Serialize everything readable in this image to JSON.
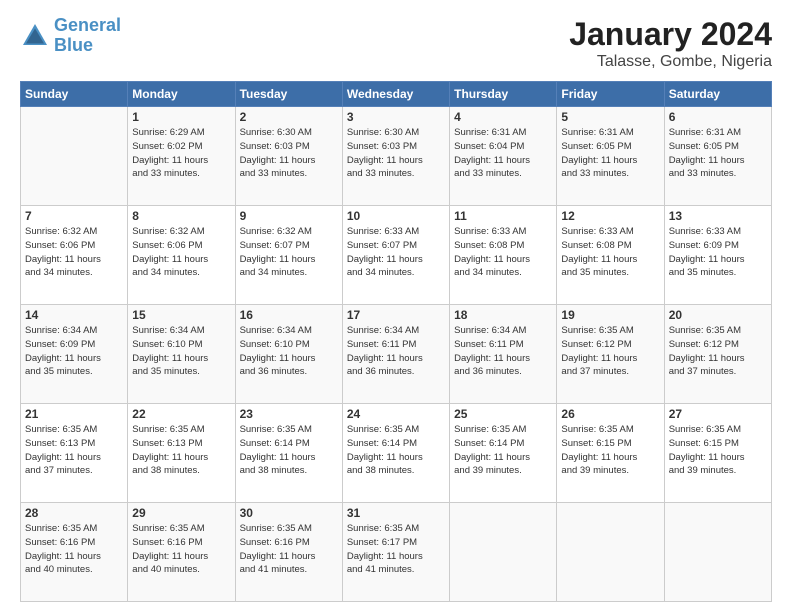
{
  "header": {
    "logo_line1": "General",
    "logo_line2": "Blue",
    "title": "January 2024",
    "subtitle": "Talasse, Gombe, Nigeria"
  },
  "days_of_week": [
    "Sunday",
    "Monday",
    "Tuesday",
    "Wednesday",
    "Thursday",
    "Friday",
    "Saturday"
  ],
  "weeks": [
    [
      {
        "day": "",
        "info": ""
      },
      {
        "day": "1",
        "info": "Sunrise: 6:29 AM\nSunset: 6:02 PM\nDaylight: 11 hours\nand 33 minutes."
      },
      {
        "day": "2",
        "info": "Sunrise: 6:30 AM\nSunset: 6:03 PM\nDaylight: 11 hours\nand 33 minutes."
      },
      {
        "day": "3",
        "info": "Sunrise: 6:30 AM\nSunset: 6:03 PM\nDaylight: 11 hours\nand 33 minutes."
      },
      {
        "day": "4",
        "info": "Sunrise: 6:31 AM\nSunset: 6:04 PM\nDaylight: 11 hours\nand 33 minutes."
      },
      {
        "day": "5",
        "info": "Sunrise: 6:31 AM\nSunset: 6:05 PM\nDaylight: 11 hours\nand 33 minutes."
      },
      {
        "day": "6",
        "info": "Sunrise: 6:31 AM\nSunset: 6:05 PM\nDaylight: 11 hours\nand 33 minutes."
      }
    ],
    [
      {
        "day": "7",
        "info": "Sunrise: 6:32 AM\nSunset: 6:06 PM\nDaylight: 11 hours\nand 34 minutes."
      },
      {
        "day": "8",
        "info": "Sunrise: 6:32 AM\nSunset: 6:06 PM\nDaylight: 11 hours\nand 34 minutes."
      },
      {
        "day": "9",
        "info": "Sunrise: 6:32 AM\nSunset: 6:07 PM\nDaylight: 11 hours\nand 34 minutes."
      },
      {
        "day": "10",
        "info": "Sunrise: 6:33 AM\nSunset: 6:07 PM\nDaylight: 11 hours\nand 34 minutes."
      },
      {
        "day": "11",
        "info": "Sunrise: 6:33 AM\nSunset: 6:08 PM\nDaylight: 11 hours\nand 34 minutes."
      },
      {
        "day": "12",
        "info": "Sunrise: 6:33 AM\nSunset: 6:08 PM\nDaylight: 11 hours\nand 35 minutes."
      },
      {
        "day": "13",
        "info": "Sunrise: 6:33 AM\nSunset: 6:09 PM\nDaylight: 11 hours\nand 35 minutes."
      }
    ],
    [
      {
        "day": "14",
        "info": "Sunrise: 6:34 AM\nSunset: 6:09 PM\nDaylight: 11 hours\nand 35 minutes."
      },
      {
        "day": "15",
        "info": "Sunrise: 6:34 AM\nSunset: 6:10 PM\nDaylight: 11 hours\nand 35 minutes."
      },
      {
        "day": "16",
        "info": "Sunrise: 6:34 AM\nSunset: 6:10 PM\nDaylight: 11 hours\nand 36 minutes."
      },
      {
        "day": "17",
        "info": "Sunrise: 6:34 AM\nSunset: 6:11 PM\nDaylight: 11 hours\nand 36 minutes."
      },
      {
        "day": "18",
        "info": "Sunrise: 6:34 AM\nSunset: 6:11 PM\nDaylight: 11 hours\nand 36 minutes."
      },
      {
        "day": "19",
        "info": "Sunrise: 6:35 AM\nSunset: 6:12 PM\nDaylight: 11 hours\nand 37 minutes."
      },
      {
        "day": "20",
        "info": "Sunrise: 6:35 AM\nSunset: 6:12 PM\nDaylight: 11 hours\nand 37 minutes."
      }
    ],
    [
      {
        "day": "21",
        "info": "Sunrise: 6:35 AM\nSunset: 6:13 PM\nDaylight: 11 hours\nand 37 minutes."
      },
      {
        "day": "22",
        "info": "Sunrise: 6:35 AM\nSunset: 6:13 PM\nDaylight: 11 hours\nand 38 minutes."
      },
      {
        "day": "23",
        "info": "Sunrise: 6:35 AM\nSunset: 6:14 PM\nDaylight: 11 hours\nand 38 minutes."
      },
      {
        "day": "24",
        "info": "Sunrise: 6:35 AM\nSunset: 6:14 PM\nDaylight: 11 hours\nand 38 minutes."
      },
      {
        "day": "25",
        "info": "Sunrise: 6:35 AM\nSunset: 6:14 PM\nDaylight: 11 hours\nand 39 minutes."
      },
      {
        "day": "26",
        "info": "Sunrise: 6:35 AM\nSunset: 6:15 PM\nDaylight: 11 hours\nand 39 minutes."
      },
      {
        "day": "27",
        "info": "Sunrise: 6:35 AM\nSunset: 6:15 PM\nDaylight: 11 hours\nand 39 minutes."
      }
    ],
    [
      {
        "day": "28",
        "info": "Sunrise: 6:35 AM\nSunset: 6:16 PM\nDaylight: 11 hours\nand 40 minutes."
      },
      {
        "day": "29",
        "info": "Sunrise: 6:35 AM\nSunset: 6:16 PM\nDaylight: 11 hours\nand 40 minutes."
      },
      {
        "day": "30",
        "info": "Sunrise: 6:35 AM\nSunset: 6:16 PM\nDaylight: 11 hours\nand 41 minutes."
      },
      {
        "day": "31",
        "info": "Sunrise: 6:35 AM\nSunset: 6:17 PM\nDaylight: 11 hours\nand 41 minutes."
      },
      {
        "day": "",
        "info": ""
      },
      {
        "day": "",
        "info": ""
      },
      {
        "day": "",
        "info": ""
      }
    ]
  ]
}
